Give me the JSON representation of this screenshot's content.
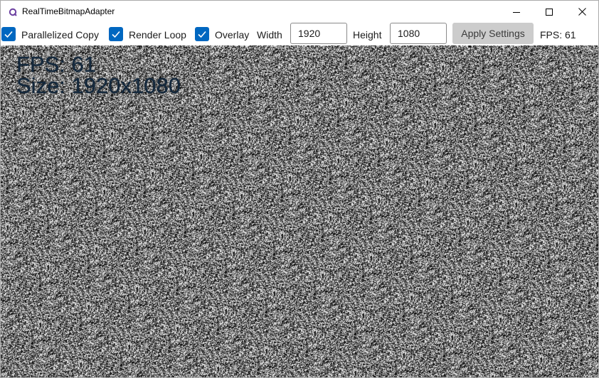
{
  "window": {
    "title": "RealTimeBitmapAdapter"
  },
  "toolbar": {
    "parallelized_copy": {
      "label": "Parallelized Copy",
      "checked": true
    },
    "render_loop": {
      "label": "Render Loop",
      "checked": true
    },
    "overlay": {
      "label": "Overlay",
      "checked": true
    },
    "width": {
      "label": "Width",
      "value": "1920"
    },
    "height": {
      "label": "Height",
      "value": "1080"
    },
    "apply_label": "Apply Settings",
    "fps_text": "FPS: 61"
  },
  "canvas": {
    "overlay_fps": "FPS: 61",
    "overlay_size": "Size: 1920x1080"
  },
  "colors": {
    "accent": "#0067c0",
    "button_bg": "#cccccc",
    "overlay_text": "#15293d"
  }
}
